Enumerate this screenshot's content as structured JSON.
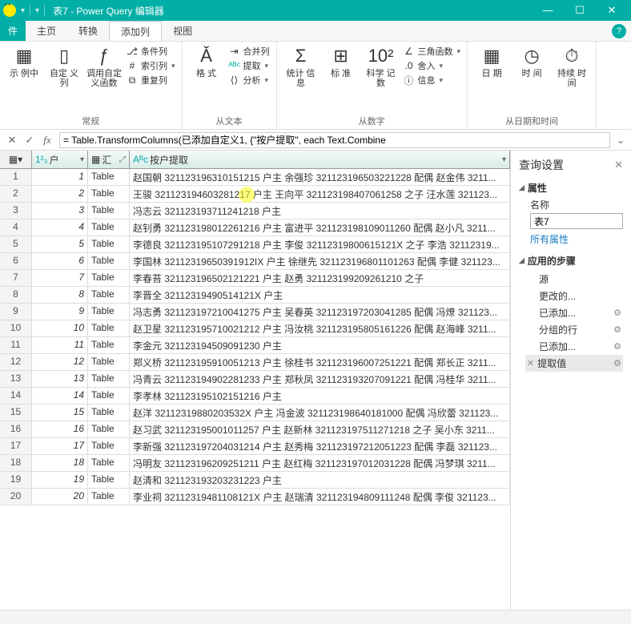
{
  "title": "表7 - Power Query 编辑器",
  "menus": {
    "file": "件",
    "home": "主页",
    "transform": "转换",
    "addcol": "添加列",
    "view": "视图"
  },
  "ribbon": {
    "g1": {
      "label": "常规",
      "example_col": "示\n例中",
      "custom_col": "自定\n义列",
      "invoke_fn": "调用自定\n义函数",
      "cond_col": "条件列",
      "index_col": "索引列",
      "dup_col": "重复列"
    },
    "g2": {
      "label": "从文本",
      "format": "格\n式",
      "merge": "合并列",
      "extract": "提取",
      "parse": "分析"
    },
    "g3": {
      "label": "从数字",
      "stats": "统计\n信息",
      "standard": "标\n准",
      "sci": "科学\n记数",
      "trig": "三角函数",
      "round": "舍入",
      "info": "信息"
    },
    "g4": {
      "label": "从日期和时间",
      "date": "日\n期",
      "time": "时\n间",
      "duration": "持续\n时间"
    }
  },
  "formula": "= Table.TransformColumns(已添加自定义1, {\"按户提取\", each Text.Combine",
  "columns": {
    "c1": "户",
    "c2": "汇",
    "c3": "按户提取"
  },
  "col_prefixes": {
    "c1": "1²₃",
    "c3": "Aᴮc"
  },
  "rows": [
    {
      "n": "1",
      "a": "1",
      "b": "Table",
      "c": "赵国朝 321123196310151215 户主 余强珍 321123196503221228 配偶 赵金伟 3211..."
    },
    {
      "n": "2",
      "a": "2",
      "b": "Table",
      "c": "王骏 321123194603281217 户主 王向平 321123198407061258 之子 汪水莲 321123..."
    },
    {
      "n": "3",
      "a": "3",
      "b": "Table",
      "c": "冯志云 321123193711241218 户主"
    },
    {
      "n": "4",
      "a": "4",
      "b": "Table",
      "c": "赵钊勇 321123198012261216 户主 富进平 321123198109011260 配偶 赵小凡 3211..."
    },
    {
      "n": "5",
      "a": "5",
      "b": "Table",
      "c": "李德良 321123195107291218 户主 李俊 32112319800615121X 之子 李浩 32112319..."
    },
    {
      "n": "6",
      "a": "6",
      "b": "Table",
      "c": "李国林 32112319650391912IX 户主 徐继先 321123196801101263 配偶 李健 321123..."
    },
    {
      "n": "7",
      "a": "7",
      "b": "Table",
      "c": "李春苔 321123196502121221 户主 赵勇 321123199209261210 之子"
    },
    {
      "n": "8",
      "a": "8",
      "b": "Table",
      "c": "李晋全 32112319490514121X 户主"
    },
    {
      "n": "9",
      "a": "9",
      "b": "Table",
      "c": "冯志勇 321123197210041275 户主 吴春英 321123197203041285 配偶 冯燎 321123..."
    },
    {
      "n": "10",
      "a": "10",
      "b": "Table",
      "c": "赵卫星 321123195710021212 户主 冯汝桃 321123195805161226 配偶 赵海峰 3211..."
    },
    {
      "n": "11",
      "a": "11",
      "b": "Table",
      "c": "李金元 321123194509091230 户主"
    },
    {
      "n": "12",
      "a": "12",
      "b": "Table",
      "c": "郑义桥 321123195910051213 户主 徐桂书 321123196007251221 配偶 郑长正 3211..."
    },
    {
      "n": "13",
      "a": "13",
      "b": "Table",
      "c": "冯青云 321123194902281233 户主 郑秋凤 321123193207091221 配偶 冯桂华 3211..."
    },
    {
      "n": "14",
      "a": "14",
      "b": "Table",
      "c": "李孝林 321123195102151216 户主"
    },
    {
      "n": "15",
      "a": "15",
      "b": "Table",
      "c": "赵洋 32112319880203532X 户主 冯金波 321123198640181000 配偶 冯欣蕾 321123..."
    },
    {
      "n": "16",
      "a": "16",
      "b": "Table",
      "c": "赵习武 321123195001011257 户主 赵新林 321123197511271218 之子 吴小东 3211..."
    },
    {
      "n": "17",
      "a": "17",
      "b": "Table",
      "c": "李新强 321123197204031214 户主 赵秀梅 321123197212051223 配偶 李磊 321123..."
    },
    {
      "n": "18",
      "a": "18",
      "b": "Table",
      "c": "冯明友 321123196209251211 户主 赵红梅 321123197012031228 配偶 冯梦琪 3211..."
    },
    {
      "n": "19",
      "a": "19",
      "b": "Table",
      "c": "赵清和 321123193203231223 户主"
    },
    {
      "n": "20",
      "a": "20",
      "b": "Table",
      "c": "李业祠 32112319481108121X 户主 赵瑞清 321123194809111248 配偶 李俊 321123..."
    }
  ],
  "side": {
    "title": "查询设置",
    "props": "属性",
    "name_label": "名称",
    "name_value": "表7",
    "all_props": "所有属性",
    "steps_title": "应用的步骤",
    "steps": [
      {
        "label": "源",
        "gear": false,
        "x": false
      },
      {
        "label": "更改的...",
        "gear": false,
        "x": false
      },
      {
        "label": "已添加...",
        "gear": true,
        "x": false
      },
      {
        "label": "分组的行",
        "gear": true,
        "x": false
      },
      {
        "label": "已添加...",
        "gear": true,
        "x": false
      },
      {
        "label": "提取值",
        "gear": true,
        "x": true,
        "sel": true
      }
    ]
  }
}
